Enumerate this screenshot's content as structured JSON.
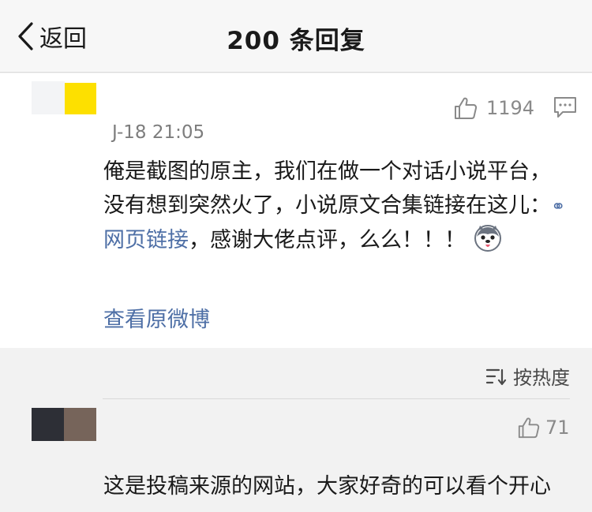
{
  "navbar": {
    "back_label": "返回",
    "title": "200 条回复"
  },
  "post": {
    "like_count": "1194",
    "timestamp": "J-18 21:05",
    "text_before_link": "俺是截图的原主，我们在做一个对话小说平台，没有想到突然火了，小说原文合集链接在这儿：",
    "link_icon": "⚭",
    "link_text": "网页链接",
    "text_after_link": "，感谢大佬点评，么么！！！",
    "emoji": "husky-emoji",
    "view_original": "查看原微博"
  },
  "sort": {
    "label": "按热度"
  },
  "reply": {
    "like_count": "71",
    "text": "这是投稿来源的网站，大家好奇的可以看个开心"
  },
  "colors": {
    "accent_link": "#4e6fa6",
    "avatar_yellow": "#fde000",
    "muted": "#8a8a8a"
  }
}
